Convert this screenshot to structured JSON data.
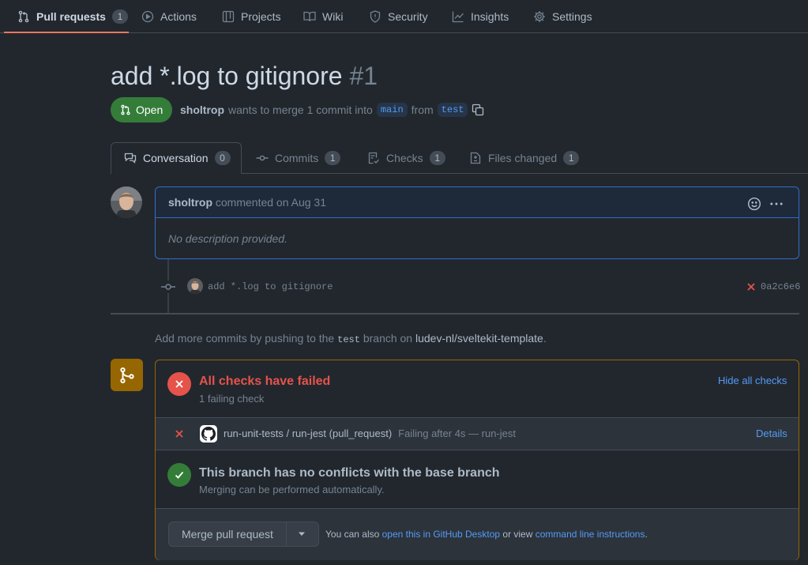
{
  "nav": {
    "pull_requests": "Pull requests",
    "pull_requests_count": "1",
    "actions": "Actions",
    "projects": "Projects",
    "wiki": "Wiki",
    "security": "Security",
    "insights": "Insights",
    "settings": "Settings"
  },
  "pr": {
    "title": "add *.log to gitignore",
    "number": "#1",
    "state": "Open",
    "author": "sholtrop",
    "merge_text": "wants to merge 1 commit into",
    "base_branch": "main",
    "from_text": "from",
    "head_branch": "test"
  },
  "tabs": {
    "conversation": "Conversation",
    "conversation_count": "0",
    "commits": "Commits",
    "commits_count": "1",
    "checks": "Checks",
    "checks_count": "1",
    "files_changed": "Files changed",
    "files_changed_count": "1"
  },
  "comment": {
    "author": "sholtrop",
    "action": "commented on Aug 31",
    "body": "No description provided."
  },
  "commit": {
    "message": "add *.log to gitignore",
    "sha": "0a2c6e6"
  },
  "push_hint": {
    "prefix": "Add more commits by pushing to the",
    "branch": "test",
    "middle": "branch on",
    "repo": "ludev-nl/sveltekit-template",
    "suffix": "."
  },
  "checks": {
    "title": "All checks have failed",
    "subtitle": "1 failing check",
    "hide_label": "Hide all checks",
    "row_name": "run-unit-tests / run-jest (pull_request)",
    "row_status": "Failing after 4s — run-jest",
    "details_label": "Details"
  },
  "conflicts": {
    "title": "This branch has no conflicts with the base branch",
    "subtitle": "Merging can be performed automatically."
  },
  "merge": {
    "button_label": "Merge pull request",
    "also_text": "You can also",
    "desktop_link": "open this in GitHub Desktop",
    "or_view": "or view",
    "cli_link": "command line instructions",
    "period": "."
  },
  "colors": {
    "background": "#22272e",
    "open_badge": "#347d39",
    "fail": "#e5534b",
    "success": "#347d39",
    "link": "#539bf5",
    "merge_border": "#966600"
  }
}
